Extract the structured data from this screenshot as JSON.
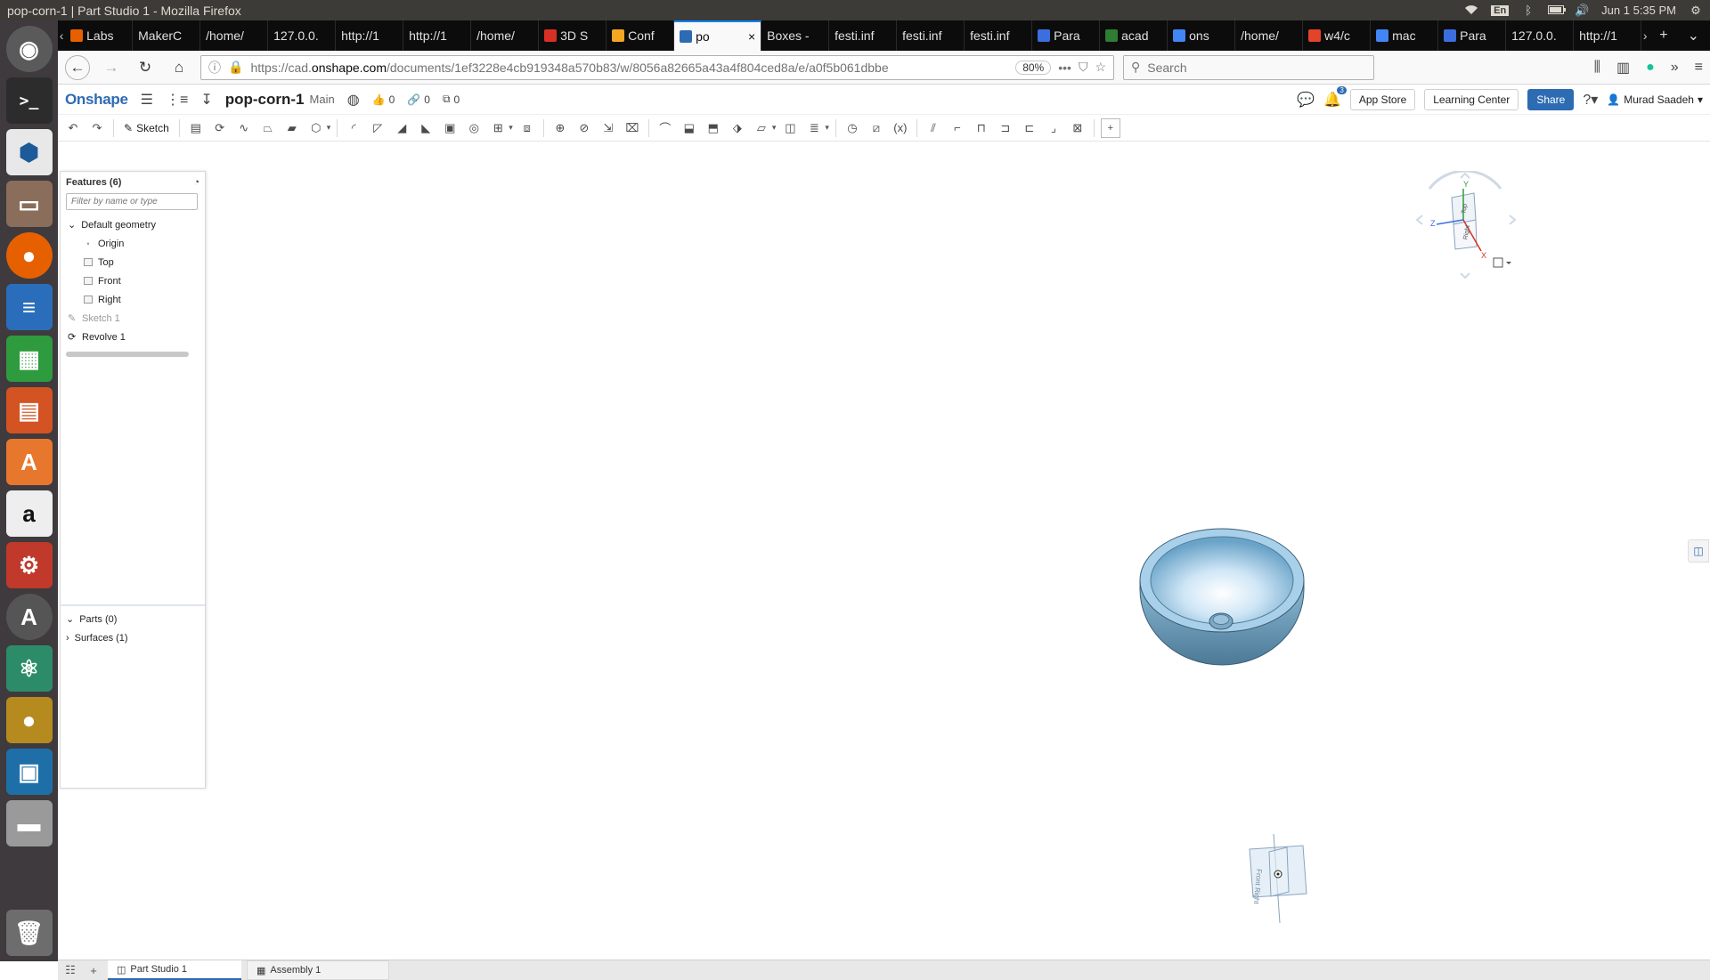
{
  "window_title": "pop-corn-1 | Part Studio 1 - Mozilla Firefox",
  "system_tray": {
    "language": "En",
    "datetime": "Jun 1  5:35 PM"
  },
  "launcher": [
    "ubuntu-home",
    "terminal",
    "cura",
    "files",
    "firefox",
    "writer",
    "calc",
    "impress",
    "software-center",
    "amazon",
    "system-settings",
    "software-updater",
    "atom",
    "freecad",
    "virtualbox",
    "disk",
    "trash"
  ],
  "browser": {
    "tabs": [
      {
        "label": "Labs",
        "icon_color": "#e66000"
      },
      {
        "label": "MakerC",
        "icon_color": ""
      },
      {
        "label": "/home/",
        "icon_color": ""
      },
      {
        "label": "127.0.0.",
        "icon_color": ""
      },
      {
        "label": "http://1",
        "icon_color": ""
      },
      {
        "label": "http://1",
        "icon_color": ""
      },
      {
        "label": "/home/",
        "icon_color": ""
      },
      {
        "label": "3D S",
        "icon_color": "#d93025"
      },
      {
        "label": "Conf",
        "icon_color": "#f5a623"
      },
      {
        "label": "po",
        "icon_color": "#2d6bb3",
        "active": true
      },
      {
        "label": "Boxes -",
        "icon_color": ""
      },
      {
        "label": "festi.inf",
        "icon_color": ""
      },
      {
        "label": "festi.inf",
        "icon_color": ""
      },
      {
        "label": "festi.inf",
        "icon_color": ""
      },
      {
        "label": "Para",
        "icon_color": "#3b6fe0"
      },
      {
        "label": "acad",
        "icon_color": "#2e7d32"
      },
      {
        "label": "ons",
        "icon_color": "#4285f4"
      },
      {
        "label": "/home/",
        "icon_color": ""
      },
      {
        "label": "w4/c",
        "icon_color": "#e24329"
      },
      {
        "label": "mac",
        "icon_color": "#4285f4"
      },
      {
        "label": "Para",
        "icon_color": "#3b6fe0"
      },
      {
        "label": "127.0.0.",
        "icon_color": ""
      },
      {
        "label": "http://1",
        "icon_color": ""
      }
    ],
    "url_prefix": "https://cad.",
    "url_host": "onshape.com",
    "url_path": "/documents/1ef3228e4cb919348a570b83/w/8056a82665a43a4f804ced8a/e/a0f5b061dbbe",
    "zoom": "80%",
    "search_placeholder": "Search"
  },
  "onshape": {
    "logo": "Onshape",
    "doc_name": "pop-corn-1",
    "workspace": "Main",
    "likes": "0",
    "links": "0",
    "copies": "0",
    "notifications": "3",
    "app_store": "App Store",
    "learning_center": "Learning Center",
    "share": "Share",
    "user": "Murad Saadeh",
    "sketch_label": "Sketch",
    "brand_color": "#2d6bb3"
  },
  "feature_panel": {
    "title": "Features (6)",
    "filter_placeholder": "Filter by name or type",
    "group": "Default geometry",
    "items": [
      {
        "label": "Origin",
        "type": "origin"
      },
      {
        "label": "Top",
        "type": "plane"
      },
      {
        "label": "Front",
        "type": "plane"
      },
      {
        "label": "Right",
        "type": "plane"
      }
    ],
    "features": [
      {
        "label": "Sketch 1",
        "dim": true
      },
      {
        "label": "Revolve 1",
        "dim": false
      }
    ],
    "parts": "Parts (0)",
    "surfaces": "Surfaces (1)"
  },
  "viewcube": {
    "top": "Top",
    "front": "Right",
    "axis_x": "X",
    "axis_y": "Y",
    "axis_z": "Z"
  },
  "triad_label": "Front Right",
  "bottom_tabs": [
    {
      "label": "Part Studio 1",
      "active": true
    },
    {
      "label": "Assembly 1",
      "active": false
    }
  ]
}
